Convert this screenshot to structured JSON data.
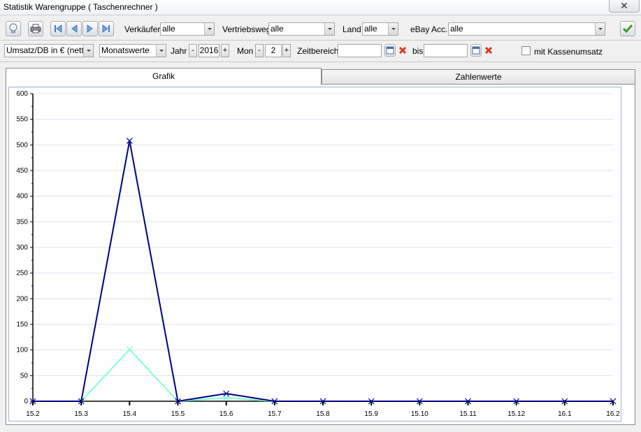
{
  "window": {
    "title": "Statistik Warengruppe ( Taschenrechner )"
  },
  "toolbar1": {
    "verkaeufer_label": "Verkäufer",
    "verkaeufer_value": "alle",
    "vertriebsweg_label": "Vertriebsweg",
    "vertriebsweg_value": "alle",
    "land_label": "Land",
    "land_value": "alle",
    "ebay_label": "eBay Acc.",
    "ebay_value": "alle"
  },
  "toolbar2": {
    "measure_value": "Umsatz/DB in € (netto",
    "period_value": "Monatswerte",
    "jahr_label": "Jahr",
    "jahr_value": "2016",
    "mon_label": "Mon",
    "mon_value": "2",
    "minus": "-",
    "plus": "+",
    "zeitbereich_label": "Zeitbereich",
    "bis_label": "bis",
    "kassen_label": "mit Kassenumsatz"
  },
  "tabs": [
    {
      "label": "Grafik",
      "active": true
    },
    {
      "label": "Zahlenwerte",
      "active": false
    }
  ],
  "icons": {
    "bulb": "lightbulb-icon",
    "print": "printer-icon",
    "first": "first-page-icon",
    "prev": "previous-icon",
    "next": "next-icon",
    "last": "last-page-icon",
    "ok": "checkmark-icon",
    "close": "close-icon",
    "calendar": "calendar-icon",
    "clear": "clear-icon"
  },
  "colors": {
    "series1": "#000080",
    "series2": "#7fffd4",
    "grid": "#dde3ee"
  },
  "chart_data": {
    "type": "line",
    "x": [
      "15.2",
      "15.3",
      "15.4",
      "15.5",
      "15.6",
      "15.7",
      "15.8",
      "15.9",
      "15.10",
      "15.11",
      "15.12",
      "16.1",
      "16.2"
    ],
    "ylim": [
      0,
      600
    ],
    "yticks": [
      0,
      50,
      100,
      150,
      200,
      250,
      300,
      350,
      400,
      450,
      500,
      550,
      600
    ],
    "grid": true,
    "series": [
      {
        "values": [
          0,
          0,
          508,
          0,
          15,
          0,
          0,
          0,
          0,
          0,
          0,
          0,
          0
        ],
        "color": "#000080"
      },
      {
        "values": [
          0,
          0,
          101,
          0,
          7,
          0,
          0,
          0,
          0,
          0,
          0,
          0,
          0
        ],
        "color": "#7fffd4"
      }
    ]
  }
}
